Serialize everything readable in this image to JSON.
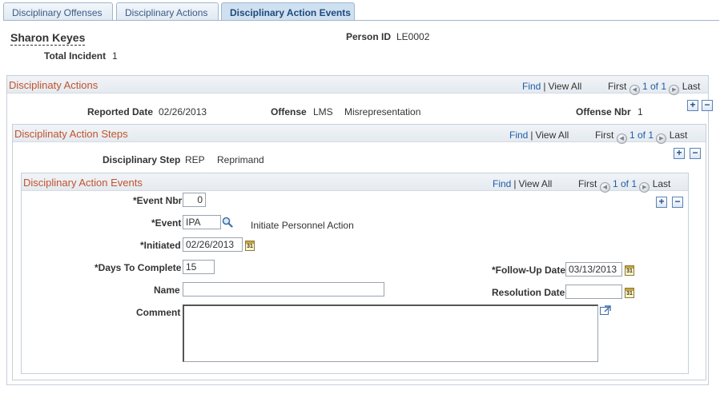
{
  "tabs": [
    {
      "label": "Disciplinary Offenses"
    },
    {
      "label": "Disciplinary Actions"
    },
    {
      "label": "Disciplinary Action Events"
    }
  ],
  "header": {
    "name": "Sharon Keyes",
    "person_id_label": "Person ID",
    "person_id": "LE0002",
    "total_incident_label": "Total Incident",
    "total_incident": "1"
  },
  "nav": {
    "find": "Find",
    "view_all": "View All",
    "first": "First",
    "count": "1 of 1",
    "last": "Last"
  },
  "actions": {
    "title": "Disciplinaty Actions",
    "reported_date_label": "Reported Date",
    "reported_date": "02/26/2013",
    "offense_label": "Offense",
    "offense_code": "LMS",
    "offense_desc": "Misrepresentation",
    "offense_nbr_label": "Offense Nbr",
    "offense_nbr": "1"
  },
  "steps": {
    "title": "Disciplinaty Action Steps",
    "step_label": "Disciplinary Step",
    "step_code": "REP",
    "step_desc": "Reprimand"
  },
  "events": {
    "title": "Disciplinary Action Events",
    "event_nbr_label": "*Event Nbr",
    "event_nbr": "0",
    "event_label": "*Event",
    "event_code": "IPA",
    "event_desc": "Initiate Personnel Action",
    "initiated_label": "*Initiated",
    "initiated": "02/26/2013",
    "days_label": "*Days To Complete",
    "days": "15",
    "followup_label": "*Follow-Up Date",
    "followup": "03/13/2013",
    "name_label": "Name",
    "name": "",
    "resolution_label": "Resolution Date",
    "resolution": "",
    "comment_label": "Comment",
    "comment": ""
  },
  "colors": {
    "section_title": "#c2532c",
    "link": "#1f5ca8",
    "tab_active_bg": "#cfe0f1"
  },
  "icons": {
    "add": "+",
    "remove": "−",
    "calendar": "31",
    "search": "magnifier",
    "expand": "expand-arrow"
  }
}
